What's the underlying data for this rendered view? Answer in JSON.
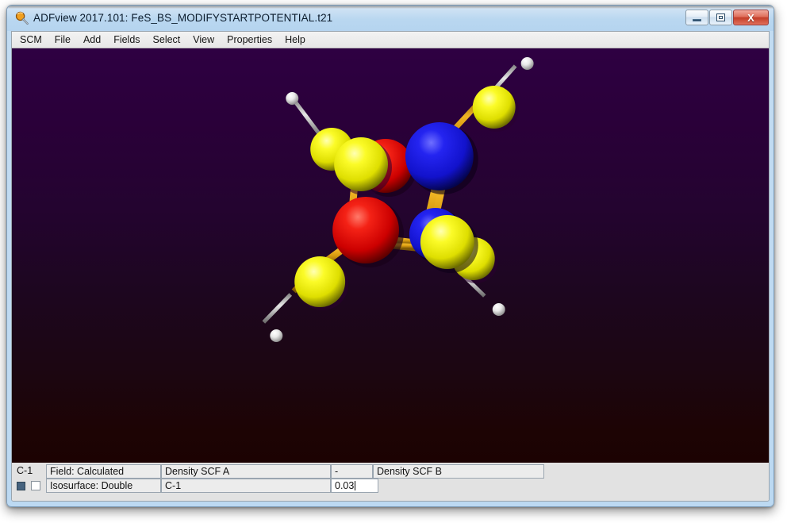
{
  "window": {
    "title": "ADFview 2017.101: FeS_BS_MODIFYSTARTPOTENTIAL.t21",
    "app_icon": "magnifier-icon",
    "buttons": {
      "minimize": "–",
      "maximize": "□",
      "close": "X"
    }
  },
  "menubar": {
    "items": [
      {
        "label": "SCM"
      },
      {
        "label": "File"
      },
      {
        "label": "Add"
      },
      {
        "label": "Fields"
      },
      {
        "label": "Select"
      },
      {
        "label": "View"
      },
      {
        "label": "Properties"
      },
      {
        "label": "Help"
      }
    ]
  },
  "viewport": {
    "background_top": "#2e0042",
    "background_bottom": "#1c0202",
    "atom_colors": {
      "iron_alpha": "#e00000",
      "iron_beta": "#1a1ae0",
      "sulfur": "#f0f000",
      "hydrogen": "#f2f2f2",
      "bond": "#d9a012"
    }
  },
  "bottom_panel": {
    "row1": {
      "id_label": "C-1",
      "field_label": "Field: Calculated",
      "field_value_a": "Density SCF A",
      "operator": "-",
      "field_value_b": "Density SCF B"
    },
    "row2": {
      "swatch_color": "#46637f",
      "checkbox_checked": false,
      "isosurface_label": "Isosurface: Double",
      "isosurface_target": "C-1",
      "isovalue": "0.03"
    }
  }
}
